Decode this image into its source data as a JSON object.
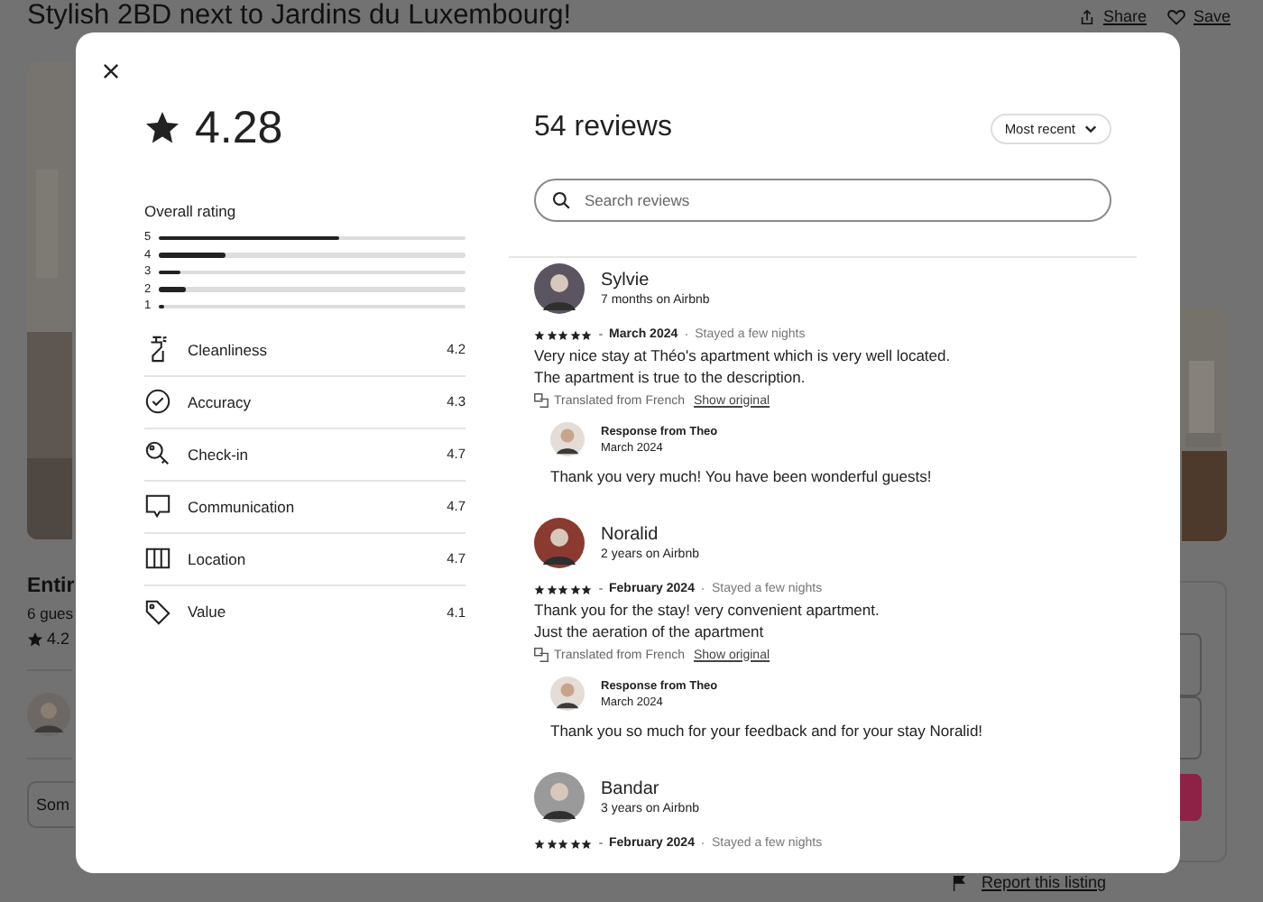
{
  "page": {
    "title": "Stylish 2BD next to Jardins du Luxembourg!",
    "share": "Share",
    "save": "Save",
    "listing_heading": "Entir",
    "guests": "6 gues",
    "rating": "4.2",
    "show_more": "Som",
    "report": "Report this listing"
  },
  "modal": {
    "rating": "4.28",
    "overall_label": "Overall rating",
    "distribution": [
      {
        "label": "5",
        "level": 0.59
      },
      {
        "label": "4",
        "level": 0.22
      },
      {
        "label": "3",
        "level": 0.07
      },
      {
        "label": "2",
        "level": 0.09
      },
      {
        "label": "1",
        "level": 0.02
      }
    ],
    "categories": [
      {
        "kind": "cleanliness",
        "name": "Cleanliness",
        "score": "4.2"
      },
      {
        "kind": "accuracy",
        "name": "Accuracy",
        "score": "4.3"
      },
      {
        "kind": "checkin",
        "name": "Check-in",
        "score": "4.7"
      },
      {
        "kind": "communication",
        "name": "Communication",
        "score": "4.7"
      },
      {
        "kind": "location",
        "name": "Location",
        "score": "4.7"
      },
      {
        "kind": "value",
        "name": "Value",
        "score": "4.1"
      }
    ],
    "review_count": "54 reviews",
    "sort": "Most recent",
    "search": {
      "placeholder": "Search reviews"
    },
    "reviews": [
      {
        "name": "Sylvie",
        "tenure": "7 months on Airbnb",
        "stars": 5,
        "date": "March 2024",
        "stay": "Stayed a few nights",
        "text": [
          "Very nice stay at Théo's apartment which is very well located.",
          "The apartment is true to the description."
        ],
        "translated": "Translated from French",
        "show_original": "Show original",
        "response": {
          "title": "Response from Theo",
          "date": "March 2024",
          "text": "Thank you very much! You have been wonderful guests!"
        }
      },
      {
        "name": "Noralid",
        "tenure": "2 years on Airbnb",
        "stars": 5,
        "date": "February 2024",
        "stay": "Stayed a few nights",
        "text": [
          "Thank you for the stay! very convenient apartment.",
          "Just the aeration of the apartment"
        ],
        "translated": "Translated from French",
        "show_original": "Show original",
        "response": {
          "title": "Response from Theo",
          "date": "March 2024",
          "text": "Thank you so much for your feedback and for your stay Noralid!"
        }
      },
      {
        "name": "Bandar",
        "tenure": "3 years on Airbnb",
        "stars": 5,
        "date": "February 2024",
        "stay": "Stayed a few nights"
      }
    ]
  }
}
